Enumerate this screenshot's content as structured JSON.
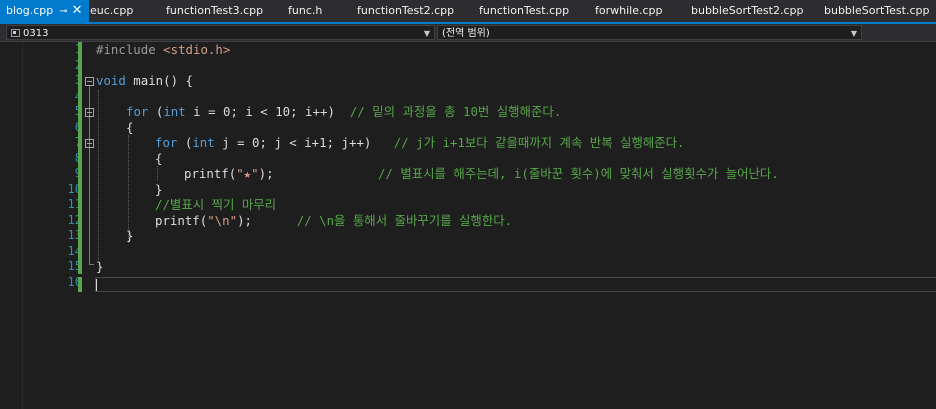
{
  "tabs": [
    {
      "label": "blog.cpp",
      "active": true,
      "pinned": true
    },
    {
      "label": "euc.cpp"
    },
    {
      "label": "functionTest3.cpp"
    },
    {
      "label": "func.h"
    },
    {
      "label": "functionTest2.cpp"
    },
    {
      "label": "functionTest.cpp"
    },
    {
      "label": "forwhile.cpp"
    },
    {
      "label": "bubbleSortTest2.cpp"
    },
    {
      "label": "bubbleSortTest.cpp"
    }
  ],
  "icons": {
    "pin": "pin-icon",
    "close": "close-icon",
    "project": "project-icon",
    "dropdown": "chevron-down-icon"
  },
  "navbar": {
    "project": "0313",
    "scope": "(전역 범위)"
  },
  "line_numbers": [
    "1",
    "2",
    "3",
    "4",
    "5",
    "6",
    "7",
    "8",
    "9",
    "10",
    "11",
    "12",
    "13",
    "14",
    "15",
    "16"
  ],
  "code": {
    "l1_pp": "#include",
    "l1_inc": "<stdio.h>",
    "l3_kw": "void",
    "l3_rest": " main() {",
    "l5_kw1": "for",
    "l5_a": " (",
    "l5_kw2": "int",
    "l5_b": " i = 0; i < 10; i++)  ",
    "l5_cm": "// 밑의 과정을 총 10번 실행해준다.",
    "l6": "{",
    "l7_kw1": "for",
    "l7_a": " (",
    "l7_kw2": "int",
    "l7_b": " j = 0; j < i+1; j++)   ",
    "l7_cm": "// j가 i+1보다 같을때까지 계속 반복 실행해준다.",
    "l8": "{",
    "l9_a": "printf(",
    "l9_str": "\"★\"",
    "l9_b": ");              ",
    "l9_cm": "// 별표시를 해주는데, i(줄바꾼 횟수)에 맞춰서 실행횟수가 늘어난다.",
    "l10": "}",
    "l11_cm": "//별표시 찍기 마무리",
    "l12_a": "printf(",
    "l12_str": "\"\\n\"",
    "l12_b": ");      ",
    "l12_cm": "// \\n을 통해서 줄바꾸기를 실행한다.",
    "l13": "}",
    "l15": "}"
  },
  "colors": {
    "accent": "#007acc",
    "keyword": "#569cd6",
    "comment": "#57a64a",
    "string": "#d69d85",
    "line_number": "#2b91af"
  }
}
